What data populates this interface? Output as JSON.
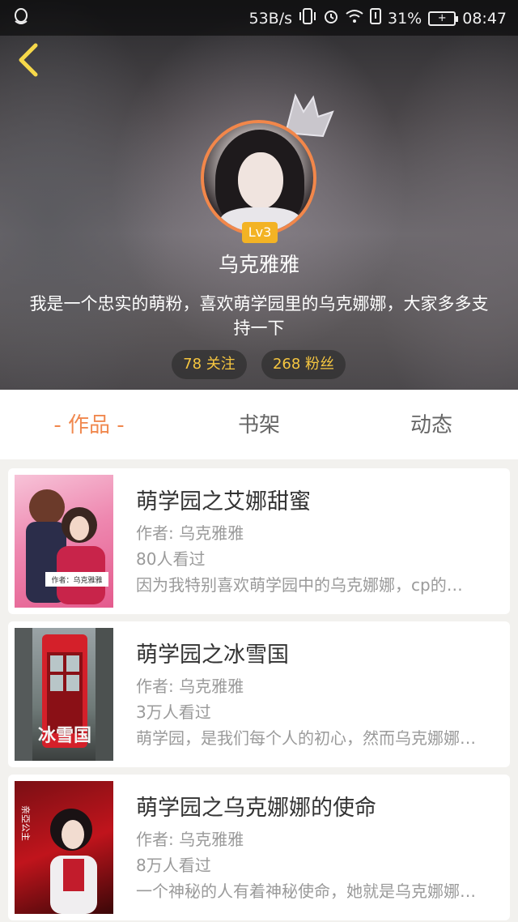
{
  "status_bar": {
    "speed": "53B/s",
    "battery_percent": "31%",
    "time": "08:47",
    "icons": [
      "qq-penguin-icon",
      "vibrate-icon",
      "alarm-icon",
      "wifi-icon",
      "sim-icon",
      "battery-icon"
    ]
  },
  "profile": {
    "level": "Lv3",
    "name": "乌克雅雅",
    "bio": "我是一个忠实的萌粉，喜欢萌学园里的乌克娜娜，大家多多支持一下",
    "follow_label": "78 关注",
    "fans_label": "268 粉丝"
  },
  "tabs": [
    {
      "label": "- 作品 -",
      "active": true
    },
    {
      "label": "书架",
      "active": false
    },
    {
      "label": "动态",
      "active": false
    }
  ],
  "works": [
    {
      "title": "萌学园之艾娜甜蜜",
      "author": "作者: 乌克雅雅",
      "views": "80人看过",
      "desc": "因为我特别喜欢萌学园中的乌克娜娜，cp的…",
      "cover_text": "作者：乌克雅雅"
    },
    {
      "title": "萌学园之冰雪国",
      "author": "作者: 乌克雅雅",
      "views": "3万人看过",
      "desc": "萌学园，是我们每个人的初心，然而乌克娜娜…",
      "cover_text": "冰雪国"
    },
    {
      "title": "萌学园之乌克娜娜的使命",
      "author": "作者: 乌克雅雅",
      "views": "8万人看过",
      "desc": "一个神秘的人有着神秘使命，她就是乌克娜娜…",
      "cover_text": "亲亞公主"
    }
  ],
  "colors": {
    "accent": "#f0884e",
    "level_badge": "#f3b324",
    "pill_text": "#f6c640",
    "back_arrow": "#f6d84a"
  }
}
